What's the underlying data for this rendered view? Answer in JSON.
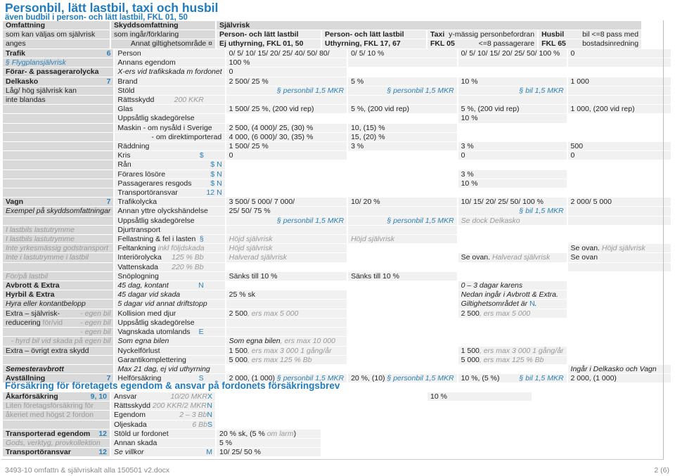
{
  "title": "Personbil, lätt lastbil, taxi och husbil",
  "subtitle": "även budbil i person- och lätt lastbil, FKL 01, 50",
  "header": {
    "omfattning": "Omfattning",
    "omfattning_sub1": "som kan väljas om självrisk",
    "omfattning_sub2": "anges",
    "skydd": "Skyddsomfattning",
    "skydd_sub1": "som ingår/förklaring",
    "skydd_sub2": "Annat giltighetsområde ¤",
    "sjalvrisk": "Självrisk",
    "c2a": "Person- och lätt lastbil",
    "c2b": "Ej uthyrning, FKL 01, 50",
    "c3a": "Person- och lätt lastbil",
    "c3b": "Uthyrning, FKL 17, 67",
    "c4a": "Taxi",
    "c4a2": "y-mässig personbefordran",
    "c4b": "FKL 05",
    "c4b2": "<=8 passagerare",
    "c5a": "Husbil",
    "c5a2": "bil <=8 pass med",
    "c5b": "FKL 65",
    "c5b2": "bostadsinredning"
  },
  "colors": {
    "accent": "#1f7bbf",
    "link": "#2a7fb5",
    "muted": "#999999"
  },
  "rows": [
    [
      [
        [
          "Trafik",
          "b"
        ],
        [
          "6",
          "n r"
        ]
      ],
      [
        [
          "Person",
          ""
        ]
      ],
      [
        [
          "0/ 5/ 10/ 15/ 20/ 25/ 40/ 50/ 80/",
          ""
        ]
      ],
      [
        [
          "0/ 5/ 10 %",
          ""
        ]
      ],
      [
        [
          "0/ 5/ 10/ 15/ 20/ 25/ 50/ 100 %",
          ""
        ]
      ],
      [
        [
          "0",
          ""
        ]
      ]
    ],
    [
      [
        [
          "§ Flygplansjälvrisk",
          "bli"
        ]
      ],
      [
        [
          "Annans egendom",
          ""
        ]
      ],
      [
        [
          "100 %",
          ""
        ]
      ],
      [],
      [],
      []
    ],
    [
      [
        [
          "Förar- & passagerarolycka",
          "b"
        ]
      ],
      [
        [
          "X-ers vid trafikskada m fordonet",
          "i"
        ]
      ],
      [
        [
          "0",
          ""
        ]
      ],
      null,
      null,
      null
    ],
    [
      [
        [
          "Delkasko",
          "b"
        ],
        [
          "7",
          "n r"
        ]
      ],
      [
        [
          "Brand",
          ""
        ]
      ],
      [
        [
          "2 500/ 25 %",
          ""
        ]
      ],
      [
        [
          "5 %",
          ""
        ]
      ],
      [
        [
          "10 %",
          ""
        ]
      ],
      [
        [
          "1 000",
          ""
        ]
      ]
    ],
    [
      [
        [
          "Låg/ hög självrisk kan",
          ""
        ]
      ],
      [
        [
          "Stöld",
          ""
        ]
      ],
      [
        [
          "§ personbil 1,5 MKR",
          "bli r"
        ]
      ],
      [
        [
          "§ personbil 1,5 MKR",
          "bli r"
        ]
      ],
      [
        [
          "§ bil 1,5 MKR",
          "bli r"
        ]
      ],
      []
    ],
    [
      [
        [
          "inte blandas",
          ""
        ]
      ],
      [
        [
          "Rättsskydd",
          ""
        ],
        [
          "200 KKR",
          "g tab"
        ]
      ],
      [],
      [],
      [],
      []
    ],
    [
      [],
      [
        [
          "Glas",
          ""
        ]
      ],
      [
        [
          "1 500/ 25 %, (200 vid rep)",
          ""
        ]
      ],
      [
        [
          "5 %, (200 vid rep)",
          ""
        ]
      ],
      [
        [
          "5 %, (200 vid rep)",
          ""
        ]
      ],
      [
        [
          "1 000, (200 vid rep)",
          ""
        ]
      ]
    ],
    [
      [],
      [
        [
          "Uppsåtlig skadegörelse",
          ""
        ]
      ],
      null,
      null,
      [
        [
          "10 %",
          ""
        ]
      ],
      null
    ],
    [
      [],
      [
        [
          "Maskin   - om nysåld i Sverige",
          ""
        ]
      ],
      [
        [
          "2 500, (4 000)/ 25, (30) %",
          ""
        ]
      ],
      [
        [
          "10, (15) %",
          ""
        ]
      ],
      null,
      null
    ],
    [
      [],
      [
        [
          "- om direktimporterad",
          "ind"
        ]
      ],
      [
        [
          "4 000, (6 000)/ 30, (35) %",
          ""
        ]
      ],
      [
        [
          "15, (20) %",
          ""
        ]
      ],
      null,
      null
    ],
    [
      [],
      [
        [
          "Räddning",
          ""
        ]
      ],
      [
        [
          "1 500/ 25 %",
          ""
        ]
      ],
      [
        [
          "3 %",
          ""
        ]
      ],
      [
        [
          "3 %",
          ""
        ]
      ],
      [
        [
          "500",
          ""
        ]
      ]
    ],
    [
      [],
      [
        [
          "Kris",
          ""
        ],
        [
          "$",
          "bl tab"
        ]
      ],
      [
        [
          "0",
          ""
        ]
      ],
      null,
      [
        [
          "0",
          ""
        ]
      ],
      [
        [
          "0",
          ""
        ]
      ]
    ],
    [
      [],
      [
        [
          "Rån",
          ""
        ],
        [
          "$ N",
          "bl r"
        ]
      ],
      null,
      null,
      null,
      null
    ],
    [
      [],
      [
        [
          "Förares lösöre",
          ""
        ],
        [
          "$ N",
          "bl r"
        ]
      ],
      null,
      null,
      [
        [
          "3 %",
          ""
        ]
      ],
      null
    ],
    [
      [],
      [
        [
          "Passagerares resgods",
          ""
        ],
        [
          "$ N",
          "bl r"
        ]
      ],
      null,
      null,
      [
        [
          "10 %",
          ""
        ]
      ],
      null
    ],
    [
      [],
      [
        [
          "Transportöransvar",
          ""
        ],
        [
          "12 N",
          "bl r"
        ]
      ],
      null,
      null,
      null,
      null
    ],
    [
      [
        [
          "Vagn",
          "b"
        ],
        [
          "7",
          "n r"
        ]
      ],
      [
        [
          "Trafikolycka",
          ""
        ]
      ],
      [
        [
          "3 500/ 5 000/ 7 000/",
          ""
        ]
      ],
      [
        [
          "10/ 20 %",
          ""
        ]
      ],
      [
        [
          "10/ 15/ 20/ 25/ 50/ 100 %",
          ""
        ]
      ],
      [
        [
          "2 000/ 5 000",
          ""
        ]
      ]
    ],
    [
      [
        [
          "Exempel på skyddsomfattningar",
          "i"
        ]
      ],
      [
        [
          "Annan yttre olyckshändelse",
          ""
        ]
      ],
      [
        [
          "25/ 50/ 75 %",
          ""
        ]
      ],
      [],
      [
        [
          "§ bil 1,5 MKR",
          "bli r"
        ]
      ],
      []
    ],
    [
      [],
      [
        [
          "Uppsåtlig skadegörelse",
          ""
        ]
      ],
      [
        [
          "§ personbil 1,5 MKR",
          "bli r"
        ]
      ],
      [
        [
          "§ personbil 1,5 MKR",
          "bli r"
        ]
      ],
      [
        [
          "Se dock Delkasko",
          "g"
        ]
      ],
      []
    ],
    [
      [
        [
          "I lastbils lastutrymme",
          "g"
        ]
      ],
      [
        [
          "Djurtransport",
          ""
        ]
      ],
      [],
      [],
      null,
      null
    ],
    [
      [
        [
          "I lastbils lastutrymme",
          "g"
        ]
      ],
      [
        [
          "Fellastning & fel i lasten",
          ""
        ],
        [
          "§",
          "bl tab"
        ]
      ],
      [
        [
          "Höjd självrisk",
          "g"
        ]
      ],
      [
        [
          "Höjd självrisk",
          "g"
        ]
      ],
      null,
      null
    ],
    [
      [
        [
          "Inte yrkesmässig godstransport",
          "g"
        ]
      ],
      [
        [
          "Feltankning ",
          ""
        ],
        [
          "inkl följdskada",
          "g"
        ]
      ],
      [
        [
          "Höjd självrisk",
          "g"
        ]
      ],
      null,
      null,
      [
        [
          "Se ovan. ",
          ""
        ],
        [
          "Höjd självrisk",
          "g"
        ]
      ]
    ],
    [
      [
        [
          "Inte i lastutrymme i lastbil",
          "g"
        ]
      ],
      [
        [
          "Interiörolycka",
          ""
        ],
        [
          "125 % Bb",
          "g tab"
        ]
      ],
      [
        [
          "Halverad självrisk",
          "g"
        ]
      ],
      null,
      [
        [
          "Se ovan. ",
          ""
        ],
        [
          "Halverad självrisk",
          "g"
        ]
      ],
      [
        [
          "Se ovan",
          ""
        ]
      ]
    ],
    [
      [],
      [
        [
          "Vattenskada",
          ""
        ],
        [
          "220 % Bb",
          "g tab"
        ]
      ],
      null,
      null,
      null,
      []
    ],
    [
      [
        [
          "För/på lastbil",
          "g"
        ]
      ],
      [
        [
          "Snöplogning",
          ""
        ]
      ],
      [
        [
          "Sänks till 10 %",
          ""
        ]
      ],
      [
        [
          "Sänks till 10 %",
          ""
        ]
      ],
      null,
      null
    ],
    [
      [
        [
          "Avbrott & Extra",
          "b"
        ]
      ],
      [
        [
          "45 dag, kontant",
          "i"
        ],
        [
          "N",
          "bl tab"
        ]
      ],
      null,
      null,
      [
        [
          "0 – 3 dagar karens",
          "i"
        ]
      ],
      null
    ],
    [
      [
        [
          "Hyrbil & Extra",
          "b"
        ]
      ],
      [
        [
          "45 dagar vid skada",
          "i"
        ]
      ],
      [
        [
          "25 % sk",
          ""
        ]
      ],
      null,
      [
        [
          "Nedan ingår i Avbrott & Extra.",
          "i"
        ]
      ],
      null
    ],
    [
      [
        [
          "Hyra eller kontantbelopp",
          "i"
        ]
      ],
      [
        [
          "5 dagar vid annat driftstopp",
          "i"
        ]
      ],
      [],
      null,
      [
        [
          "Giltighetsområdet är ",
          "i"
        ],
        [
          "N",
          "bl"
        ],
        [
          ".",
          "i"
        ]
      ],
      null
    ],
    [
      [
        [
          "Extra – självrisk-",
          ""
        ],
        [
          "- egen bil",
          "g r"
        ]
      ],
      [
        [
          "Kollision med djur",
          ""
        ]
      ],
      [
        [
          "2 500",
          ""
        ],
        [
          ", ers max 5 000",
          "g"
        ]
      ],
      null,
      [
        [
          "2 500",
          ""
        ],
        [
          ", ers max 5 000",
          "g"
        ]
      ],
      null
    ],
    [
      [
        [
          "reducering ",
          ""
        ],
        [
          "för/vid",
          "gn"
        ],
        [
          "- egen bil",
          "g r"
        ]
      ],
      [
        [
          "Uppsåtlig skadegörelse",
          ""
        ]
      ],
      [],
      null,
      null,
      null
    ],
    [
      [
        [
          "- egen bil",
          "g r"
        ]
      ],
      [
        [
          "Vagnskada utomlands",
          ""
        ],
        [
          "E",
          "bl tab"
        ]
      ],
      [],
      null,
      null,
      null
    ],
    [
      [
        [
          "- hyrd bil vid skada på egen bil",
          "g r"
        ]
      ],
      [
        [
          "Som egna bilen",
          "i"
        ]
      ],
      [
        [
          "Som egna bilen",
          "i"
        ],
        [
          ", ers max 10 000",
          "g"
        ]
      ],
      null,
      null,
      null
    ],
    [
      [
        [
          "Extra – övrigt extra skydd",
          ""
        ]
      ],
      [
        [
          "Nyckelförlust",
          ""
        ]
      ],
      [
        [
          "1 500",
          ""
        ],
        [
          ", ers max 3 000 1 gång/år",
          "g"
        ]
      ],
      null,
      [
        [
          "1 500",
          ""
        ],
        [
          ", ers max 3 000 1 gång/år",
          "g"
        ]
      ],
      null
    ],
    [
      [],
      [
        [
          "Garantikomplettering",
          ""
        ]
      ],
      [
        [
          "5 000",
          ""
        ],
        [
          ", ers max 125 % Bb",
          "g"
        ]
      ],
      null,
      [
        [
          "5 000",
          ""
        ],
        [
          ", ers max 125 % Bb",
          "g"
        ]
      ],
      null
    ],
    [
      [
        [
          "Semesteravbrott",
          "b i"
        ]
      ],
      [
        [
          "Max 21 dag, ej vid uthyrning",
          "i"
        ]
      ],
      null,
      null,
      null,
      [
        [
          "Ingår i Delkasko och Vagn",
          "i"
        ]
      ]
    ],
    [
      [
        [
          "Avställning",
          "b"
        ],
        [
          "7",
          "n r"
        ]
      ],
      [
        [
          "Helförsäkring",
          ""
        ],
        [
          "S",
          "bl tab"
        ]
      ],
      [
        [
          "2 000, (1 000) ",
          ""
        ],
        [
          "§ personbil 1,5 MKR",
          "bli"
        ]
      ],
      [
        [
          "20 %, (10)  ",
          ""
        ],
        [
          "§ personbil 1,5 MKR",
          "bli"
        ]
      ],
      [
        [
          "10 %, (5 %)",
          ""
        ],
        [
          "§ bil 1,5 MKR",
          "bli r"
        ]
      ],
      [
        [
          "2 000, (1 000)",
          ""
        ]
      ]
    ]
  ],
  "section_title": "Försäkring för företagets egendom & ansvar på fordonets försäkringsbrev",
  "rows2": [
    [
      [
        [
          "Åkarförsäkring",
          "b"
        ],
        [
          "9, 10",
          "n r"
        ]
      ],
      [
        [
          "Ansvar",
          ""
        ],
        [
          "X",
          "bl r"
        ],
        [
          "10/20 MKR",
          "g r"
        ]
      ],
      null,
      null,
      [
        [
          "10 %",
          ""
        ]
      ],
      null
    ],
    [
      [
        [
          "Liten företagsförsäkring för",
          "gn"
        ]
      ],
      [
        [
          "Rättsskydd ",
          ""
        ],
        [
          "200 KKR/2 MKR",
          "g"
        ],
        [
          "N",
          "bl r"
        ]
      ],
      null,
      null,
      null,
      null
    ],
    [
      [
        [
          "åkeriet med högst 2 fordon",
          "gn"
        ]
      ],
      [
        [
          "Egendom",
          ""
        ],
        [
          "N",
          "bl r"
        ],
        [
          "2 – 3 Bb",
          "g r"
        ]
      ],
      null,
      null,
      null,
      null
    ],
    [
      [],
      [
        [
          "Oljeskada",
          ""
        ],
        [
          "S",
          "bl r"
        ],
        [
          "6 Bb",
          "g r"
        ]
      ],
      null,
      null,
      null,
      null
    ],
    [
      [
        [
          "Transporterad egendom",
          "b"
        ],
        [
          "12",
          "n r"
        ]
      ],
      [
        [
          "Stöld ur fordonet",
          ""
        ]
      ],
      [
        [
          "20 % sk, (5 % ",
          ""
        ],
        [
          "om larm",
          "g"
        ],
        [
          ")",
          ""
        ]
      ],
      null,
      null,
      null
    ],
    [
      [
        [
          "Gods, verktyg, provkollektion",
          "g"
        ]
      ],
      [
        [
          "Annan skada",
          ""
        ]
      ],
      [
        [
          "5 %",
          ""
        ]
      ],
      null,
      null,
      null
    ],
    [
      [
        [
          "Transportöransvar",
          "b"
        ],
        [
          "12",
          "n r"
        ]
      ],
      [
        [
          "Se villkor",
          "i"
        ],
        [
          "M",
          "bl r"
        ]
      ],
      [
        [
          "10/ 25/ 50 %",
          ""
        ]
      ],
      null,
      null,
      null
    ]
  ],
  "footer": {
    "file": "3493-10 omfattn & självriskalt alla 150501 v2.docx",
    "page": "2 (6)"
  }
}
